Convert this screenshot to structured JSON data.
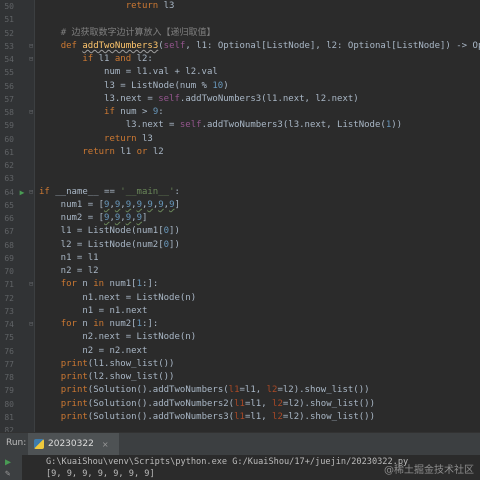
{
  "editor": {
    "lines": [
      {
        "n": "50",
        "ic": "",
        "fold": "",
        "t": [
          [
            "                ",
            ""
          ],
          [
            "return",
            "kw"
          ],
          [
            " l3",
            ""
          ]
        ]
      },
      {
        "n": "51",
        "ic": "",
        "fold": "",
        "t": []
      },
      {
        "n": "52",
        "ic": "",
        "fold": "",
        "t": [
          [
            "    ",
            ""
          ],
          [
            "# 边获取数字边计算放入【递归取值】",
            "cmt"
          ]
        ]
      },
      {
        "n": "53",
        "ic": "",
        "fold": "⊟",
        "t": [
          [
            "    ",
            ""
          ],
          [
            "def ",
            "kw"
          ],
          [
            "addTwoNumbers3",
            "fn"
          ],
          [
            "(",
            ""
          ],
          [
            "self",
            "sf"
          ],
          [
            ", l1: Optional[ListNode], l2: Optional[ListNode]) -> Optional[ListNode]:",
            ""
          ]
        ]
      },
      {
        "n": "54",
        "ic": "",
        "fold": "⊟",
        "t": [
          [
            "        ",
            ""
          ],
          [
            "if ",
            "kw"
          ],
          [
            "l1 ",
            ""
          ],
          [
            "and ",
            "kw"
          ],
          [
            "l2:",
            ""
          ]
        ]
      },
      {
        "n": "55",
        "ic": "",
        "fold": "",
        "t": [
          [
            "            num = l1.val + l2.val",
            ""
          ]
        ]
      },
      {
        "n": "56",
        "ic": "",
        "fold": "",
        "t": [
          [
            "            l3 = ListNode(num % ",
            ""
          ],
          [
            "10",
            "num"
          ],
          [
            ")",
            ""
          ]
        ]
      },
      {
        "n": "57",
        "ic": "",
        "fold": "",
        "t": [
          [
            "            l3.next = ",
            ""
          ],
          [
            "self",
            "sf"
          ],
          [
            ".addTwoNumbers3(l1.next, l2.next)",
            ""
          ]
        ]
      },
      {
        "n": "58",
        "ic": "",
        "fold": "⊟",
        "t": [
          [
            "            ",
            ""
          ],
          [
            "if ",
            "kw"
          ],
          [
            "num > ",
            ""
          ],
          [
            "9",
            "num"
          ],
          [
            ":",
            ""
          ]
        ]
      },
      {
        "n": "59",
        "ic": "",
        "fold": "",
        "t": [
          [
            "                l3.next = ",
            ""
          ],
          [
            "self",
            "sf"
          ],
          [
            ".addTwoNumbers3(l3.next, ListNode(",
            ""
          ],
          [
            "1",
            "num"
          ],
          [
            "))",
            ""
          ]
        ]
      },
      {
        "n": "60",
        "ic": "",
        "fold": "",
        "t": [
          [
            "            ",
            ""
          ],
          [
            "return ",
            "kw"
          ],
          [
            "l3",
            ""
          ]
        ]
      },
      {
        "n": "61",
        "ic": "",
        "fold": "",
        "t": [
          [
            "        ",
            ""
          ],
          [
            "return ",
            "kw"
          ],
          [
            "l1 ",
            ""
          ],
          [
            "or ",
            "kw"
          ],
          [
            "l2",
            ""
          ]
        ]
      },
      {
        "n": "62",
        "ic": "",
        "fold": "",
        "t": []
      },
      {
        "n": "63",
        "ic": "",
        "fold": "",
        "t": []
      },
      {
        "n": "64",
        "ic": "▶",
        "fold": "⊟",
        "t": [
          [
            "if ",
            "kw"
          ],
          [
            "__name__ == ",
            ""
          ],
          [
            "'__main__'",
            "str"
          ],
          [
            ":",
            ""
          ]
        ]
      },
      {
        "n": "65",
        "ic": "",
        "fold": "",
        "t": [
          [
            "    num1 = [",
            ""
          ],
          [
            "9",
            "num"
          ],
          [
            ",",
            ""
          ],
          [
            "9",
            "num"
          ],
          [
            ",",
            ""
          ],
          [
            "9",
            "num"
          ],
          [
            ",",
            ""
          ],
          [
            "9",
            "num"
          ],
          [
            ",",
            ""
          ],
          [
            "9",
            "num"
          ],
          [
            ",",
            ""
          ],
          [
            "9",
            "num"
          ],
          [
            ",",
            ""
          ],
          [
            "9",
            "num"
          ],
          [
            "]",
            ""
          ]
        ]
      },
      {
        "n": "66",
        "ic": "",
        "fold": "",
        "t": [
          [
            "    num2 = [",
            ""
          ],
          [
            "9",
            "num"
          ],
          [
            ",",
            ""
          ],
          [
            "9",
            "num"
          ],
          [
            ",",
            ""
          ],
          [
            "9",
            "num"
          ],
          [
            ",",
            ""
          ],
          [
            "9",
            "num"
          ],
          [
            "]",
            ""
          ]
        ]
      },
      {
        "n": "67",
        "ic": "",
        "fold": "",
        "t": [
          [
            "    l1 = ListNode(num1[",
            ""
          ],
          [
            "0",
            "num"
          ],
          [
            "])",
            ""
          ]
        ]
      },
      {
        "n": "68",
        "ic": "",
        "fold": "",
        "t": [
          [
            "    l2 = ListNode(num2[",
            ""
          ],
          [
            "0",
            "num"
          ],
          [
            "])",
            ""
          ]
        ]
      },
      {
        "n": "69",
        "ic": "",
        "fold": "",
        "t": [
          [
            "    n1 = l1",
            ""
          ]
        ]
      },
      {
        "n": "70",
        "ic": "",
        "fold": "",
        "t": [
          [
            "    n2 = l2",
            ""
          ]
        ]
      },
      {
        "n": "71",
        "ic": "",
        "fold": "⊟",
        "t": [
          [
            "    ",
            ""
          ],
          [
            "for ",
            "kw"
          ],
          [
            "n ",
            ""
          ],
          [
            "in ",
            "kw"
          ],
          [
            "num1[",
            ""
          ],
          [
            "1",
            "num"
          ],
          [
            ":]:",
            ""
          ]
        ]
      },
      {
        "n": "72",
        "ic": "",
        "fold": "",
        "t": [
          [
            "        n1.next = ListNode(n)",
            ""
          ]
        ]
      },
      {
        "n": "73",
        "ic": "",
        "fold": "",
        "t": [
          [
            "        n1 = n1.next",
            ""
          ]
        ]
      },
      {
        "n": "74",
        "ic": "",
        "fold": "⊟",
        "t": [
          [
            "    ",
            ""
          ],
          [
            "for ",
            "kw"
          ],
          [
            "n ",
            ""
          ],
          [
            "in ",
            "kw"
          ],
          [
            "num2[",
            ""
          ],
          [
            "1",
            "num"
          ],
          [
            ":]:",
            ""
          ]
        ]
      },
      {
        "n": "75",
        "ic": "",
        "fold": "",
        "t": [
          [
            "        n2.next = ListNode(n)",
            ""
          ]
        ]
      },
      {
        "n": "76",
        "ic": "",
        "fold": "",
        "t": [
          [
            "        n2 = n2.next",
            ""
          ]
        ]
      },
      {
        "n": "77",
        "ic": "",
        "fold": "",
        "t": [
          [
            "    ",
            ""
          ],
          [
            "print",
            "kw"
          ],
          [
            "(l1.show_list())",
            ""
          ]
        ]
      },
      {
        "n": "78",
        "ic": "",
        "fold": "",
        "t": [
          [
            "    ",
            ""
          ],
          [
            "print",
            "kw"
          ],
          [
            "(l2.show_list())",
            ""
          ]
        ]
      },
      {
        "n": "79",
        "ic": "",
        "fold": "",
        "t": [
          [
            "    ",
            ""
          ],
          [
            "print",
            "kw"
          ],
          [
            "(Solution().addTwoNumbers(",
            ""
          ],
          [
            "l1",
            "pk"
          ],
          [
            "=l1, ",
            ""
          ],
          [
            "l2",
            "pk"
          ],
          [
            "=l2).show_list())",
            ""
          ]
        ]
      },
      {
        "n": "80",
        "ic": "",
        "fold": "",
        "t": [
          [
            "    ",
            ""
          ],
          [
            "print",
            "kw"
          ],
          [
            "(Solution().addTwoNumbers2(",
            ""
          ],
          [
            "l1",
            "pk"
          ],
          [
            "=l1, ",
            ""
          ],
          [
            "l2",
            "pk"
          ],
          [
            "=l2).show_list())",
            ""
          ]
        ]
      },
      {
        "n": "81",
        "ic": "",
        "fold": "",
        "t": [
          [
            "    ",
            ""
          ],
          [
            "print",
            "kw"
          ],
          [
            "(Solution().addTwoNumbers3(",
            ""
          ],
          [
            "l1",
            "pk"
          ],
          [
            "=l1, ",
            ""
          ],
          [
            "l2",
            "pk"
          ],
          [
            "=l2).show_list())",
            ""
          ]
        ]
      },
      {
        "n": "82",
        "ic": "",
        "fold": "",
        "t": []
      }
    ]
  },
  "run_panel": {
    "label": "Run:",
    "tab_name": "20230322",
    "tab_close": "×",
    "run_icon": "▶",
    "wrench_icon": "🔧",
    "console_line_1": "G:\\KuaiShou\\venv\\Scripts\\python.exe G:/KuaiShou/17+/juejin/20230322.py",
    "console_line_2": "[9, 9, 9, 9, 9, 9, 9]",
    "watermark": "@稀土掘金技术社区"
  }
}
